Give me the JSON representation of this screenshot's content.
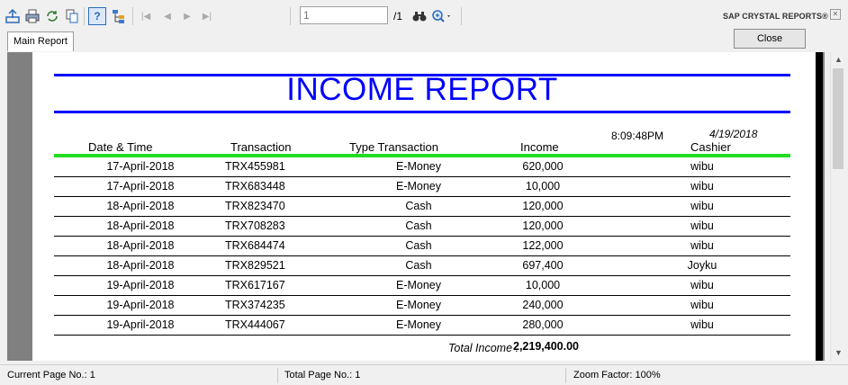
{
  "toolbar": {
    "page_input_value": "1",
    "page_total": "/1",
    "brand": "SAP CRYSTAL REPORTS®",
    "icons": [
      "export-icon",
      "print-icon",
      "refresh-icon",
      "copy-icon",
      "help-icon",
      "group-tree-icon",
      "first-page-icon",
      "prev-page-icon",
      "next-page-icon",
      "last-page-icon",
      "find-icon",
      "zoom-icon"
    ]
  },
  "tabs": {
    "main_report": "Main Report"
  },
  "close_button": "Close",
  "report": {
    "title": "INCOME REPORT",
    "print_time": "8:09:48PM",
    "print_date": "4/19/2018",
    "headers": {
      "date_time": "Date & Time",
      "transaction": "Transaction",
      "type": "Type Transaction",
      "income": "Income",
      "cashier": "Cashier"
    },
    "rows": [
      {
        "date": "17-April-2018",
        "trx": "TRX455981",
        "type": "E-Money",
        "income": "620,000",
        "cashier": "wibu"
      },
      {
        "date": "17-April-2018",
        "trx": "TRX683448",
        "type": "E-Money",
        "income": "10,000",
        "cashier": "wibu"
      },
      {
        "date": "18-April-2018",
        "trx": "TRX823470",
        "type": "Cash",
        "income": "120,000",
        "cashier": "wibu"
      },
      {
        "date": "18-April-2018",
        "trx": "TRX708283",
        "type": "Cash",
        "income": "120,000",
        "cashier": "wibu"
      },
      {
        "date": "18-April-2018",
        "trx": "TRX684474",
        "type": "Cash",
        "income": "122,000",
        "cashier": "wibu"
      },
      {
        "date": "18-April-2018",
        "trx": "TRX829521",
        "type": "Cash",
        "income": "697,400",
        "cashier": "Joyku"
      },
      {
        "date": "19-April-2018",
        "trx": "TRX617167",
        "type": "E-Money",
        "income": "10,000",
        "cashier": "wibu"
      },
      {
        "date": "19-April-2018",
        "trx": "TRX374235",
        "type": "E-Money",
        "income": "240,000",
        "cashier": "wibu"
      },
      {
        "date": "19-April-2018",
        "trx": "TRX444067",
        "type": "E-Money",
        "income": "280,000",
        "cashier": "wibu"
      }
    ],
    "total_label": "Total Income :",
    "total_value": "2,219,400.00"
  },
  "status": {
    "current_page": "Current Page No.: 1",
    "total_page": "Total Page No.: 1",
    "zoom": "Zoom Factor: 100%"
  },
  "colors": {
    "title_blue": "#0000ff",
    "header_rule_green": "#22dd22"
  }
}
